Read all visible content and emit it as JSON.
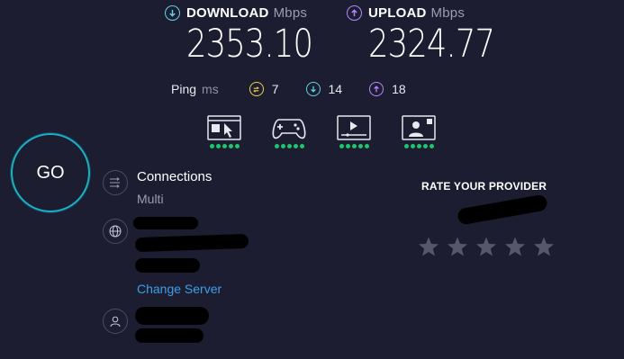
{
  "download": {
    "label": "DOWNLOAD",
    "unit": "Mbps",
    "value": "2353.10"
  },
  "upload": {
    "label": "UPLOAD",
    "unit": "Mbps",
    "value": "2324.77"
  },
  "ping": {
    "label": "Ping",
    "unit": "ms",
    "idle": "7",
    "down": "14",
    "up": "18"
  },
  "experience": [
    {
      "name": "browsing",
      "rating": 5
    },
    {
      "name": "gaming",
      "rating": 5
    },
    {
      "name": "streaming",
      "rating": 5
    },
    {
      "name": "video-chat",
      "rating": 5
    }
  ],
  "go": {
    "label": "GO"
  },
  "connections": {
    "label": "Connections",
    "value": "Multi"
  },
  "server": {
    "change_label": "Change Server"
  },
  "rate": {
    "title": "RATE YOUR PROVIDER",
    "stars": 5
  },
  "colors": {
    "background": "#1c1d30",
    "download": "#5fd4e6",
    "upload": "#b887ff",
    "idle": "#f2d04b",
    "go_ring": "#1ab0c4",
    "link": "#3ca0e8",
    "good": "#1fc46b"
  }
}
